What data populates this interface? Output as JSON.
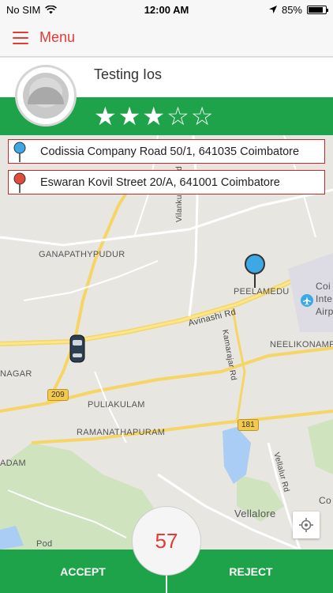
{
  "status_bar": {
    "carrier": "No SIM",
    "time": "12:00 AM",
    "battery": "85%",
    "battery_level": 0.85
  },
  "nav": {
    "menu_label": "Menu"
  },
  "driver": {
    "name": "Testing Ios",
    "rating": 3,
    "rating_max": 5
  },
  "trip": {
    "pickup_address": "Codissia Company Road 50/1, 641035 Coimbatore",
    "drop_address": "Eswaran Kovil Street 20/A, 641001 Coimbatore"
  },
  "map": {
    "labels": {
      "ganapathypudur": "GANAPATHYPUDUR",
      "peelamedu": "PEELAMEDU",
      "avinashi_rd": "Avinashi Rd",
      "neelikonampal": "NEELIKONAMPAL",
      "nagar": "NAGAR",
      "puliakulam": "PULIAKULAM",
      "ramanathapuram": "RAMANATHAPURAM",
      "vellalore": "Vellalore",
      "vilankurichi_rd": "Vilankurichi Rd",
      "kamarajar_rd": "Kamarajar Rd",
      "vellalur_rd": "Vellalur Rd",
      "coi": "Coi",
      "inte": "Inte",
      "airp": "Airp",
      "adam": "ADAM",
      "pod": "Pod",
      "co": "Co"
    },
    "badges": {
      "nh209": "209",
      "nh181": "181"
    }
  },
  "timer": {
    "value": "57"
  },
  "actions": {
    "accept_label": "ACCEPT",
    "reject_label": "REJECT"
  },
  "colors": {
    "brand_green": "#1ea34a",
    "accent_red": "#e53935",
    "pickup_pin": "#3ea8e5",
    "drop_pin": "#e04b3c"
  }
}
